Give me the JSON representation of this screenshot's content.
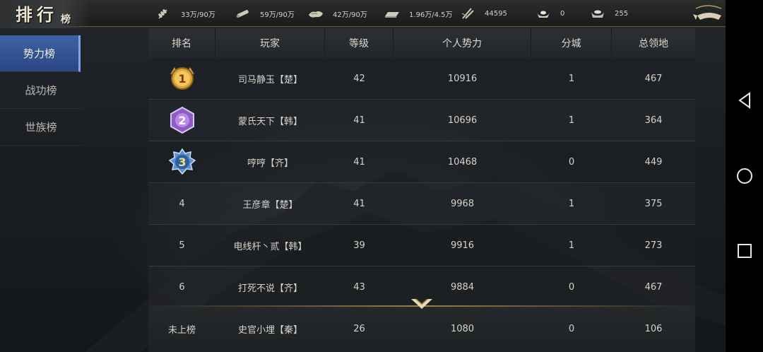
{
  "header": {
    "title": "排行",
    "title_sub": "榜"
  },
  "resources": [
    {
      "icon": "grain-icon",
      "value": "33万/90万"
    },
    {
      "icon": "wood-icon",
      "value": "59万/90万"
    },
    {
      "icon": "stone-icon",
      "value": "42万/90万"
    },
    {
      "icon": "iron-icon",
      "value": "1.96万/4.5万"
    },
    {
      "icon": "copper-icon",
      "value": "44595"
    },
    {
      "icon": "gold-ingot-icon",
      "value": "0"
    },
    {
      "icon": "silver-ingot-icon",
      "value": "255"
    }
  ],
  "tabs": [
    {
      "label": "势力榜",
      "active": true
    },
    {
      "label": "战功榜",
      "active": false
    },
    {
      "label": "世族榜",
      "active": false
    }
  ],
  "table": {
    "columns": [
      "排名",
      "玩家",
      "等级",
      "个人势力",
      "分城",
      "总领地"
    ],
    "rows": [
      {
        "rank": "1",
        "medal": "gold",
        "player": "司马静玉【楚】",
        "level": "42",
        "power": "10916",
        "cities": "1",
        "territory": "467"
      },
      {
        "rank": "2",
        "medal": "purple",
        "player": "蒙氏天下【韩】",
        "level": "41",
        "power": "10696",
        "cities": "1",
        "territory": "364"
      },
      {
        "rank": "3",
        "medal": "blue",
        "player": "哼哼【齐】",
        "level": "41",
        "power": "10468",
        "cities": "0",
        "territory": "449"
      },
      {
        "rank": "4",
        "medal": "",
        "player": "王彦章【楚】",
        "level": "41",
        "power": "9968",
        "cities": "1",
        "territory": "375"
      },
      {
        "rank": "5",
        "medal": "",
        "player": "电线杆丶贰【韩】",
        "level": "39",
        "power": "9916",
        "cities": "1",
        "territory": "273"
      },
      {
        "rank": "6",
        "medal": "",
        "player": "打死不说【齐】",
        "level": "43",
        "power": "9884",
        "cities": "0",
        "territory": "467"
      }
    ],
    "self": {
      "rank": "未上榜",
      "player": "史官小埋【秦】",
      "level": "26",
      "power": "1080",
      "cities": "0",
      "territory": "106"
    }
  },
  "colors": {
    "accent_tab": "#3f62a6",
    "gold_line": "#9c7d45",
    "text": "#d7d3c8"
  }
}
